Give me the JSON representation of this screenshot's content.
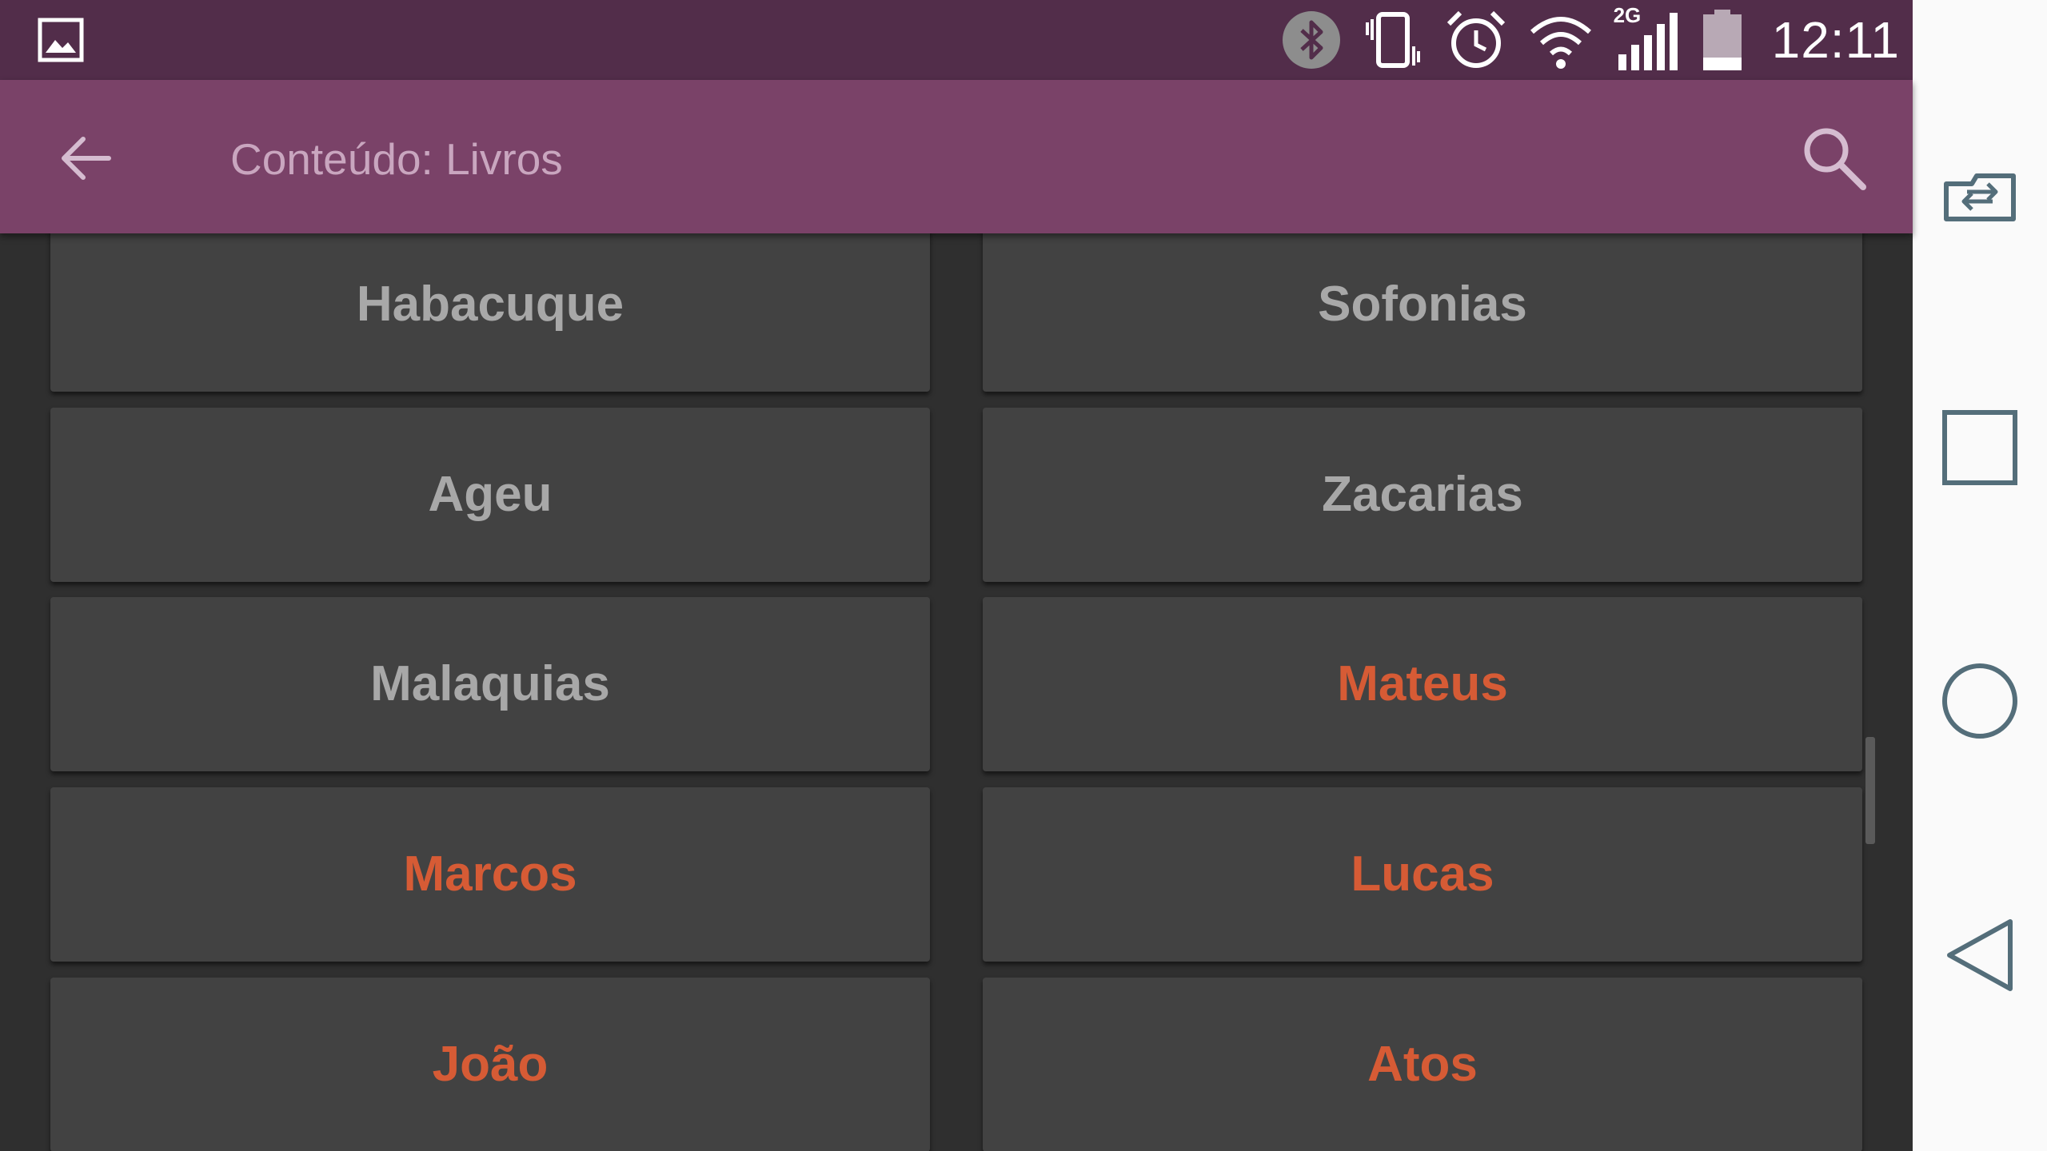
{
  "status_bar": {
    "time": "12:11",
    "network_type": "2G",
    "icons": [
      "gallery-notification-icon",
      "bluetooth-icon",
      "vibrate-icon",
      "alarm-icon",
      "wifi-icon",
      "cell-signal-icon",
      "battery-icon"
    ]
  },
  "app_bar": {
    "title": "Conteúdo: Livros",
    "back_icon": "arrow-left-icon",
    "search_icon": "search-icon"
  },
  "books": [
    {
      "label": "Habacuque",
      "testament": "old"
    },
    {
      "label": "Sofonias",
      "testament": "old"
    },
    {
      "label": "Ageu",
      "testament": "old"
    },
    {
      "label": "Zacarias",
      "testament": "old"
    },
    {
      "label": "Malaquias",
      "testament": "old"
    },
    {
      "label": "Mateus",
      "testament": "new"
    },
    {
      "label": "Marcos",
      "testament": "new"
    },
    {
      "label": "Lucas",
      "testament": "new"
    },
    {
      "label": "João",
      "testament": "new"
    },
    {
      "label": "Atos",
      "testament": "new"
    }
  ],
  "colors": {
    "status_bar": "#522d4a",
    "app_bar": "#7a4268",
    "title_text": "#c9a6bf",
    "background": "#2f2f2f",
    "card": "#424242",
    "old_testament_text": "#a8a8a8",
    "new_testament_text": "#d65b35",
    "nav_bar": "#fafafa",
    "nav_icon": "#546e7a"
  },
  "nav_bar": {
    "icons": [
      "dual-window-icon",
      "recents-icon",
      "home-icon",
      "back-icon"
    ]
  }
}
